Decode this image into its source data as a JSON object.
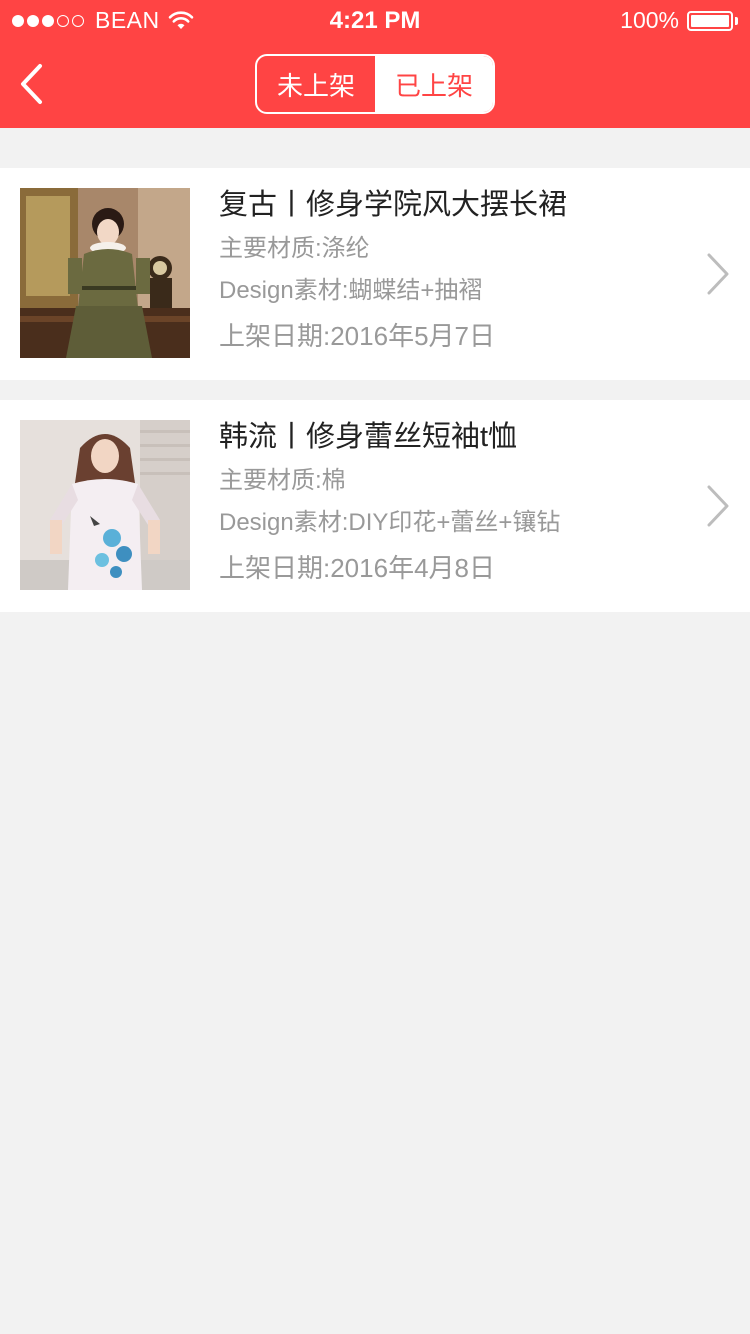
{
  "status_bar": {
    "carrier": "BEAN",
    "time": "4:21 PM",
    "battery": "100%",
    "signal_icons": [
      "signal-dot-filled",
      "signal-dot-filled",
      "signal-dot-filled",
      "signal-dot-empty",
      "signal-dot-empty"
    ],
    "wifi_icon": "wifi-icon"
  },
  "header": {
    "back_icon": "chevron-left-icon",
    "tabs": [
      {
        "label": "未上架",
        "active": false
      },
      {
        "label": "已上架",
        "active": true
      }
    ],
    "color": "#ff4444"
  },
  "products": [
    {
      "title": "复古丨修身学院风大摆长裙",
      "material": "主要材质:涤纶",
      "design": "Design素材:蝴蝶结+抽褶",
      "date": "上架日期:2016年5月7日"
    },
    {
      "title": "韩流丨修身蕾丝短袖t恤",
      "material": "主要材质:棉",
      "design": "Design素材:DIY印花+蕾丝+镶钻",
      "date": "上架日期:2016年4月8日"
    }
  ]
}
